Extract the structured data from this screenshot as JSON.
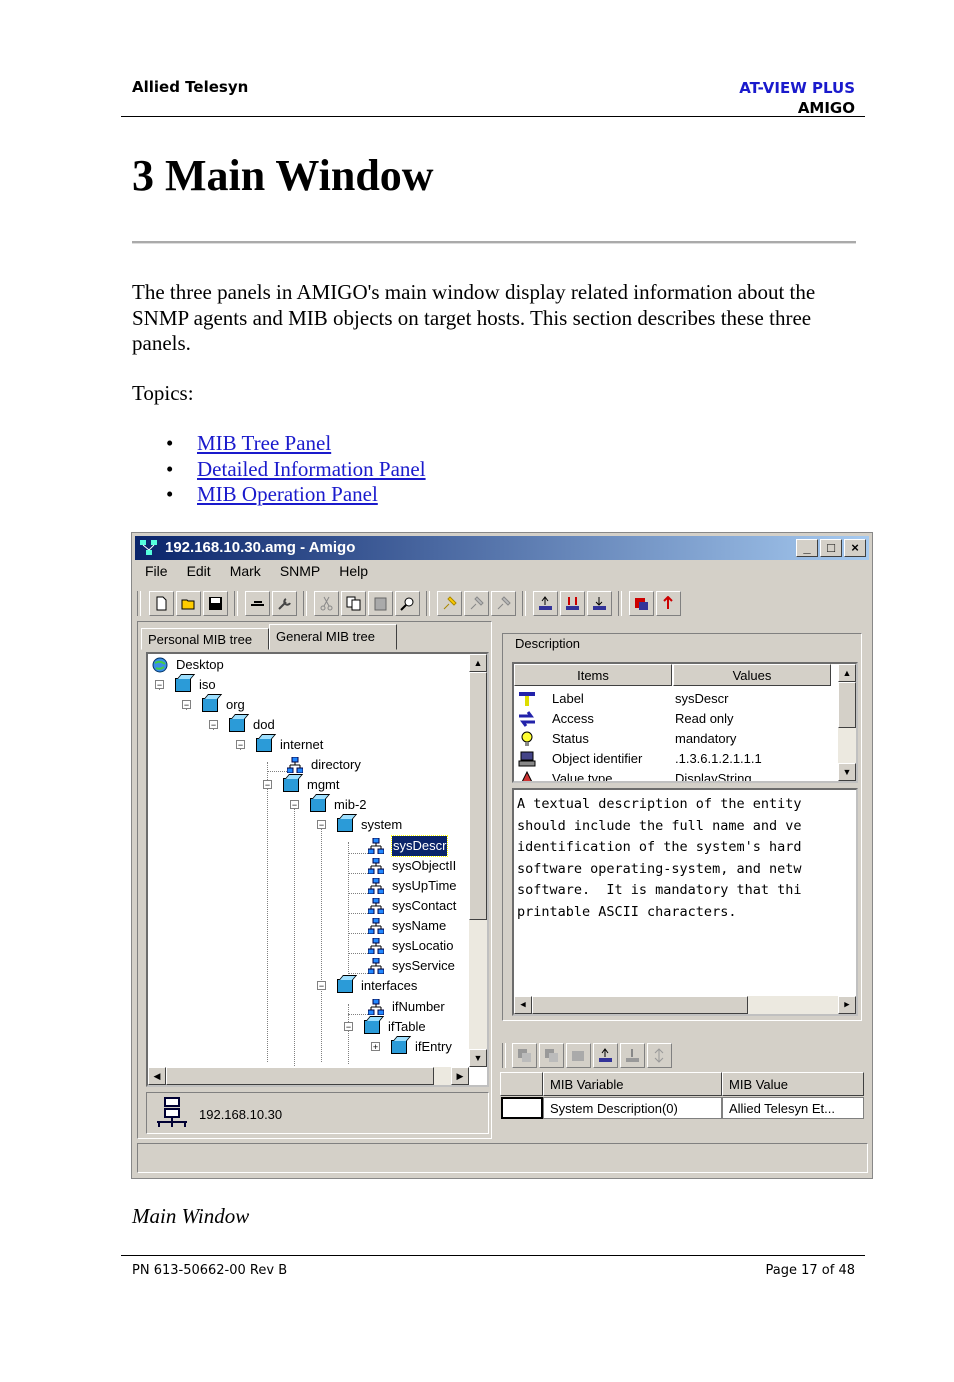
{
  "header": {
    "company": "Allied Telesyn",
    "product": "AT-VIEW PLUS",
    "module": "AMIGO"
  },
  "page_title": "3 Main Window",
  "intro": "The three panels in AMIGO's main window display related information about the SNMP agents and MIB objects on target hosts. This section describes these three panels.",
  "topics_label": "Topics:",
  "topics": [
    {
      "label": "MIB Tree Panel"
    },
    {
      "label": "Detailed Information Panel"
    },
    {
      "label": "MIB Operation Panel"
    }
  ],
  "window": {
    "title": "192.168.10.30.amg - Amigo",
    "title_buttons": [
      "_",
      "□",
      "×"
    ],
    "menu": [
      "File",
      "Edit",
      "Mark",
      "SNMP",
      "Help"
    ],
    "tabs": [
      "Personal MIB tree",
      "General MIB tree"
    ],
    "active_tab": "General MIB tree",
    "tree": [
      {
        "label": "Desktop",
        "icon": "globe-icon"
      },
      {
        "label": "iso",
        "icon": "cube-icon",
        "expanded": true
      },
      {
        "label": "org",
        "icon": "cube-icon",
        "expanded": true
      },
      {
        "label": "dod",
        "icon": "cube-icon",
        "expanded": true
      },
      {
        "label": "internet",
        "icon": "cube-icon",
        "expanded": true
      },
      {
        "label": "directory",
        "icon": "leaf-node-icon"
      },
      {
        "label": "mgmt",
        "icon": "cube-icon",
        "expanded": true
      },
      {
        "label": "mib-2",
        "icon": "cube-icon",
        "expanded": true
      },
      {
        "label": "system",
        "icon": "cube-icon",
        "expanded": true
      },
      {
        "label": "sysDescr",
        "icon": "leaf-node-icon",
        "selected": true
      },
      {
        "label": "sysObjectII",
        "icon": "leaf-node-icon"
      },
      {
        "label": "sysUpTime",
        "icon": "leaf-node-icon"
      },
      {
        "label": "sysContact",
        "icon": "leaf-node-icon"
      },
      {
        "label": "sysName",
        "icon": "leaf-node-icon"
      },
      {
        "label": "sysLocatio",
        "icon": "leaf-node-icon"
      },
      {
        "label": "sysService",
        "icon": "leaf-node-icon"
      },
      {
        "label": "interfaces",
        "icon": "cube-icon",
        "expanded": true
      },
      {
        "label": "ifNumber",
        "icon": "leaf-node-icon"
      },
      {
        "label": "ifTable",
        "icon": "cube-icon",
        "expanded": true
      },
      {
        "label": "ifEntry",
        "icon": "cube-icon",
        "expanded": false
      }
    ],
    "host": "192.168.10.30",
    "description_label": "Description",
    "grid_headers": [
      "Items",
      "Values"
    ],
    "grid_rows": [
      {
        "item": "Label",
        "value": "sysDescr",
        "icon": "label-icon"
      },
      {
        "item": "Access",
        "value": "Read only",
        "icon": "access-icon"
      },
      {
        "item": "Status",
        "value": "mandatory",
        "icon": "status-bulb-icon"
      },
      {
        "item": "Object identifier",
        "value": ".1.3.6.1.2.1.1.1",
        "icon": "object-id-icon"
      },
      {
        "item": "Value type",
        "value": "DisplayString",
        "icon": "value-type-icon"
      }
    ],
    "description_text": "A textual description of the entity\nshould include the full name and ve\nidentification of the system's hard\nsoftware operating-system, and netw\nsoftware.  It is mandatory that thi\nprintable ASCII characters.",
    "op_headers": [
      "MIB Variable",
      "MIB Value"
    ],
    "op_row": {
      "variable": "System Description(0)",
      "value": "Allied Telesyn Et..."
    }
  },
  "caption": "Main Window",
  "footer": {
    "part_number": "PN 613-50662-00 Rev B",
    "page": "Page 17 of 48"
  },
  "colors": {
    "link": "#1a1acc",
    "titlebar_start": "#0a246a",
    "titlebar_end": "#a6caf0",
    "window_face": "#d4d0c8"
  }
}
